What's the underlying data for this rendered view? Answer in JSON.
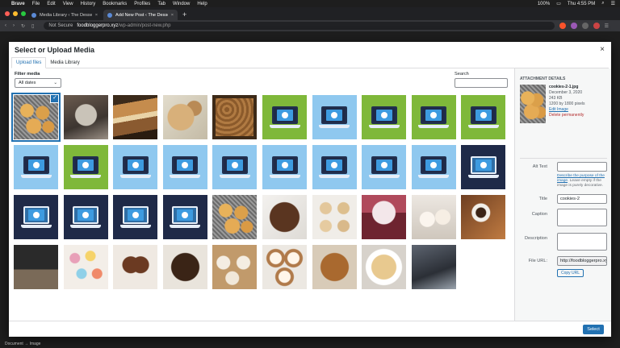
{
  "menubar": {
    "app": "Brave",
    "items": [
      "File",
      "Edit",
      "View",
      "History",
      "Bookmarks",
      "Profiles",
      "Tab",
      "Window",
      "Help"
    ],
    "battery": "100%",
    "clock": "Thu 4:55 PM"
  },
  "tabs": [
    {
      "title": "Media Library ‹ The Dessert Fo",
      "active": false
    },
    {
      "title": "Add New Post ‹ The Dessert Fo",
      "active": true
    }
  ],
  "address": {
    "security": "Not Secure",
    "host": "foodbloggerpro.xyz",
    "path": "/wp-admin/post-new.php"
  },
  "modal": {
    "title": "Select or Upload Media",
    "close_icon": "×",
    "router_tabs": [
      "Upload files",
      "Media Library"
    ],
    "filter_label": "Filter media",
    "filter_value": "All dates",
    "search_label": "Search",
    "select_button": "Select"
  },
  "thumbnails": [
    {
      "kind": "photo",
      "style": "cookie",
      "selected": true
    },
    {
      "kind": "photo",
      "style": "cat"
    },
    {
      "kind": "photo",
      "style": "bars"
    },
    {
      "kind": "photo",
      "style": "granola"
    },
    {
      "kind": "photo",
      "style": "tray"
    },
    {
      "kind": "ill",
      "bg": "green"
    },
    {
      "kind": "ill",
      "bg": "blue"
    },
    {
      "kind": "ill",
      "bg": "green"
    },
    {
      "kind": "ill",
      "bg": "green"
    },
    {
      "kind": "ill",
      "bg": "green"
    },
    {
      "kind": "ill",
      "bg": "blue"
    },
    {
      "kind": "ill",
      "bg": "green"
    },
    {
      "kind": "ill",
      "bg": "blue"
    },
    {
      "kind": "ill",
      "bg": "blue"
    },
    {
      "kind": "ill",
      "bg": "blue"
    },
    {
      "kind": "ill",
      "bg": "blue"
    },
    {
      "kind": "ill",
      "bg": "blue"
    },
    {
      "kind": "ill",
      "bg": "blue"
    },
    {
      "kind": "ill",
      "bg": "blue"
    },
    {
      "kind": "ill",
      "bg": "navy"
    },
    {
      "kind": "ill",
      "bg": "navy"
    },
    {
      "kind": "ill",
      "bg": "navy"
    },
    {
      "kind": "ill",
      "bg": "navy"
    },
    {
      "kind": "ill",
      "bg": "navy"
    },
    {
      "kind": "photo",
      "style": "cookie"
    },
    {
      "kind": "photo",
      "style": "dark-cookie"
    },
    {
      "kind": "photo",
      "style": "choc-cookies"
    },
    {
      "kind": "photo",
      "style": "cupcake"
    },
    {
      "kind": "photo",
      "style": "white-cupcake"
    },
    {
      "kind": "photo",
      "style": "coffee"
    },
    {
      "kind": "photo",
      "style": "chalk"
    },
    {
      "kind": "photo",
      "style": "donuts"
    },
    {
      "kind": "photo",
      "style": "heart"
    },
    {
      "kind": "photo",
      "style": "pan"
    },
    {
      "kind": "photo",
      "style": "cupcakes-row"
    },
    {
      "kind": "photo",
      "style": "frosted"
    },
    {
      "kind": "photo",
      "style": "pecan"
    },
    {
      "kind": "photo",
      "style": "chip-cookie"
    },
    {
      "kind": "photo",
      "style": "laptop"
    }
  ],
  "attachment": {
    "heading": "Attachment Details",
    "filename": "cookies-2-1.jpg",
    "date": "December 3, 2020",
    "size": "243 KB",
    "dimensions": "1200 by 1800 pixels",
    "edit_link": "Edit Image",
    "delete_link": "Delete permanently",
    "alt_label": "Alt Text",
    "alt_help_link": "Describe the purpose of the image",
    "alt_help_text": ". Leave empty if the image is purely decorative.",
    "title_label": "Title",
    "title_value": "cookies-2",
    "caption_label": "Caption",
    "description_label": "Description",
    "url_label": "File URL:",
    "url_value": "http://foodbloggerpro.xyz",
    "copy_button": "Copy URL"
  },
  "statusbar": "Document  →  Image",
  "colors": {
    "accent": "#2271b1",
    "delete": "#b32d2e"
  }
}
